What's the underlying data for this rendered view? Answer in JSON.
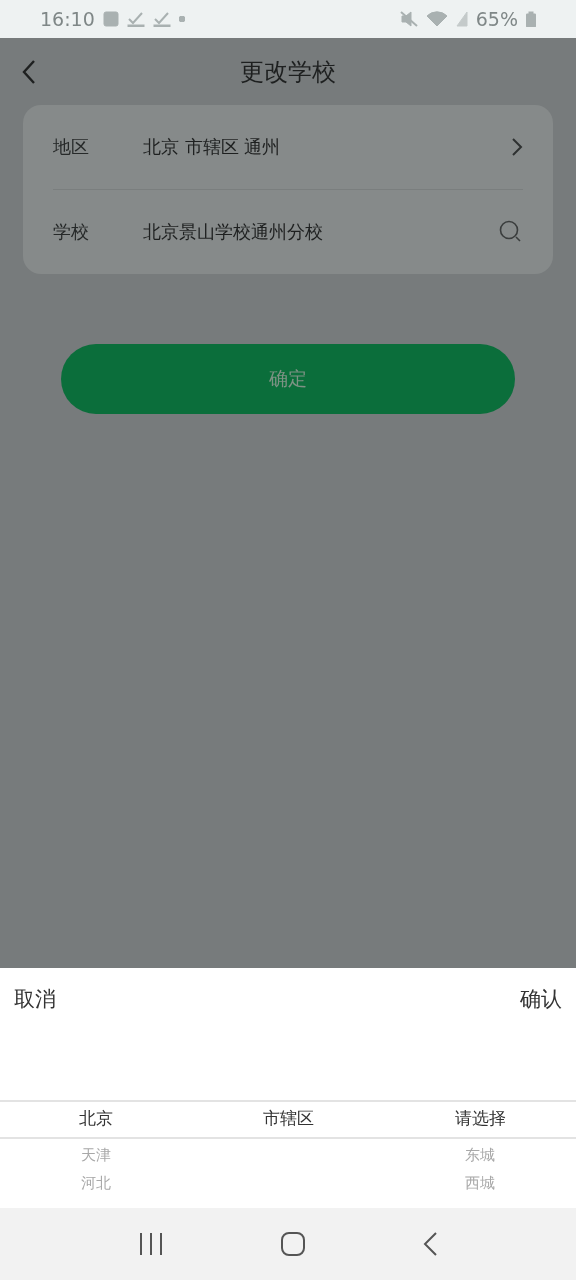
{
  "status_bar": {
    "time": "16:10",
    "battery": "65%"
  },
  "header": {
    "title": "更改学校"
  },
  "form": {
    "rows": [
      {
        "kind": "select",
        "label": "地区",
        "value": "北京 市辖区 通州"
      },
      {
        "kind": "search",
        "label": "学校",
        "value": "北京景山学校通州分校"
      }
    ]
  },
  "confirm_button": {
    "label": "确定"
  },
  "picker": {
    "cancel": "取消",
    "confirm": "确认",
    "columns": [
      {
        "items": [
          {
            "label": "北京",
            "selected": true
          },
          {
            "label": "天津",
            "selected": false
          },
          {
            "label": "河北",
            "selected": false
          }
        ]
      },
      {
        "items": [
          {
            "label": "市辖区",
            "selected": true
          }
        ]
      },
      {
        "items": [
          {
            "label": "请选择",
            "selected": true
          },
          {
            "label": "东城",
            "selected": false
          },
          {
            "label": "西城",
            "selected": false
          }
        ]
      }
    ]
  }
}
